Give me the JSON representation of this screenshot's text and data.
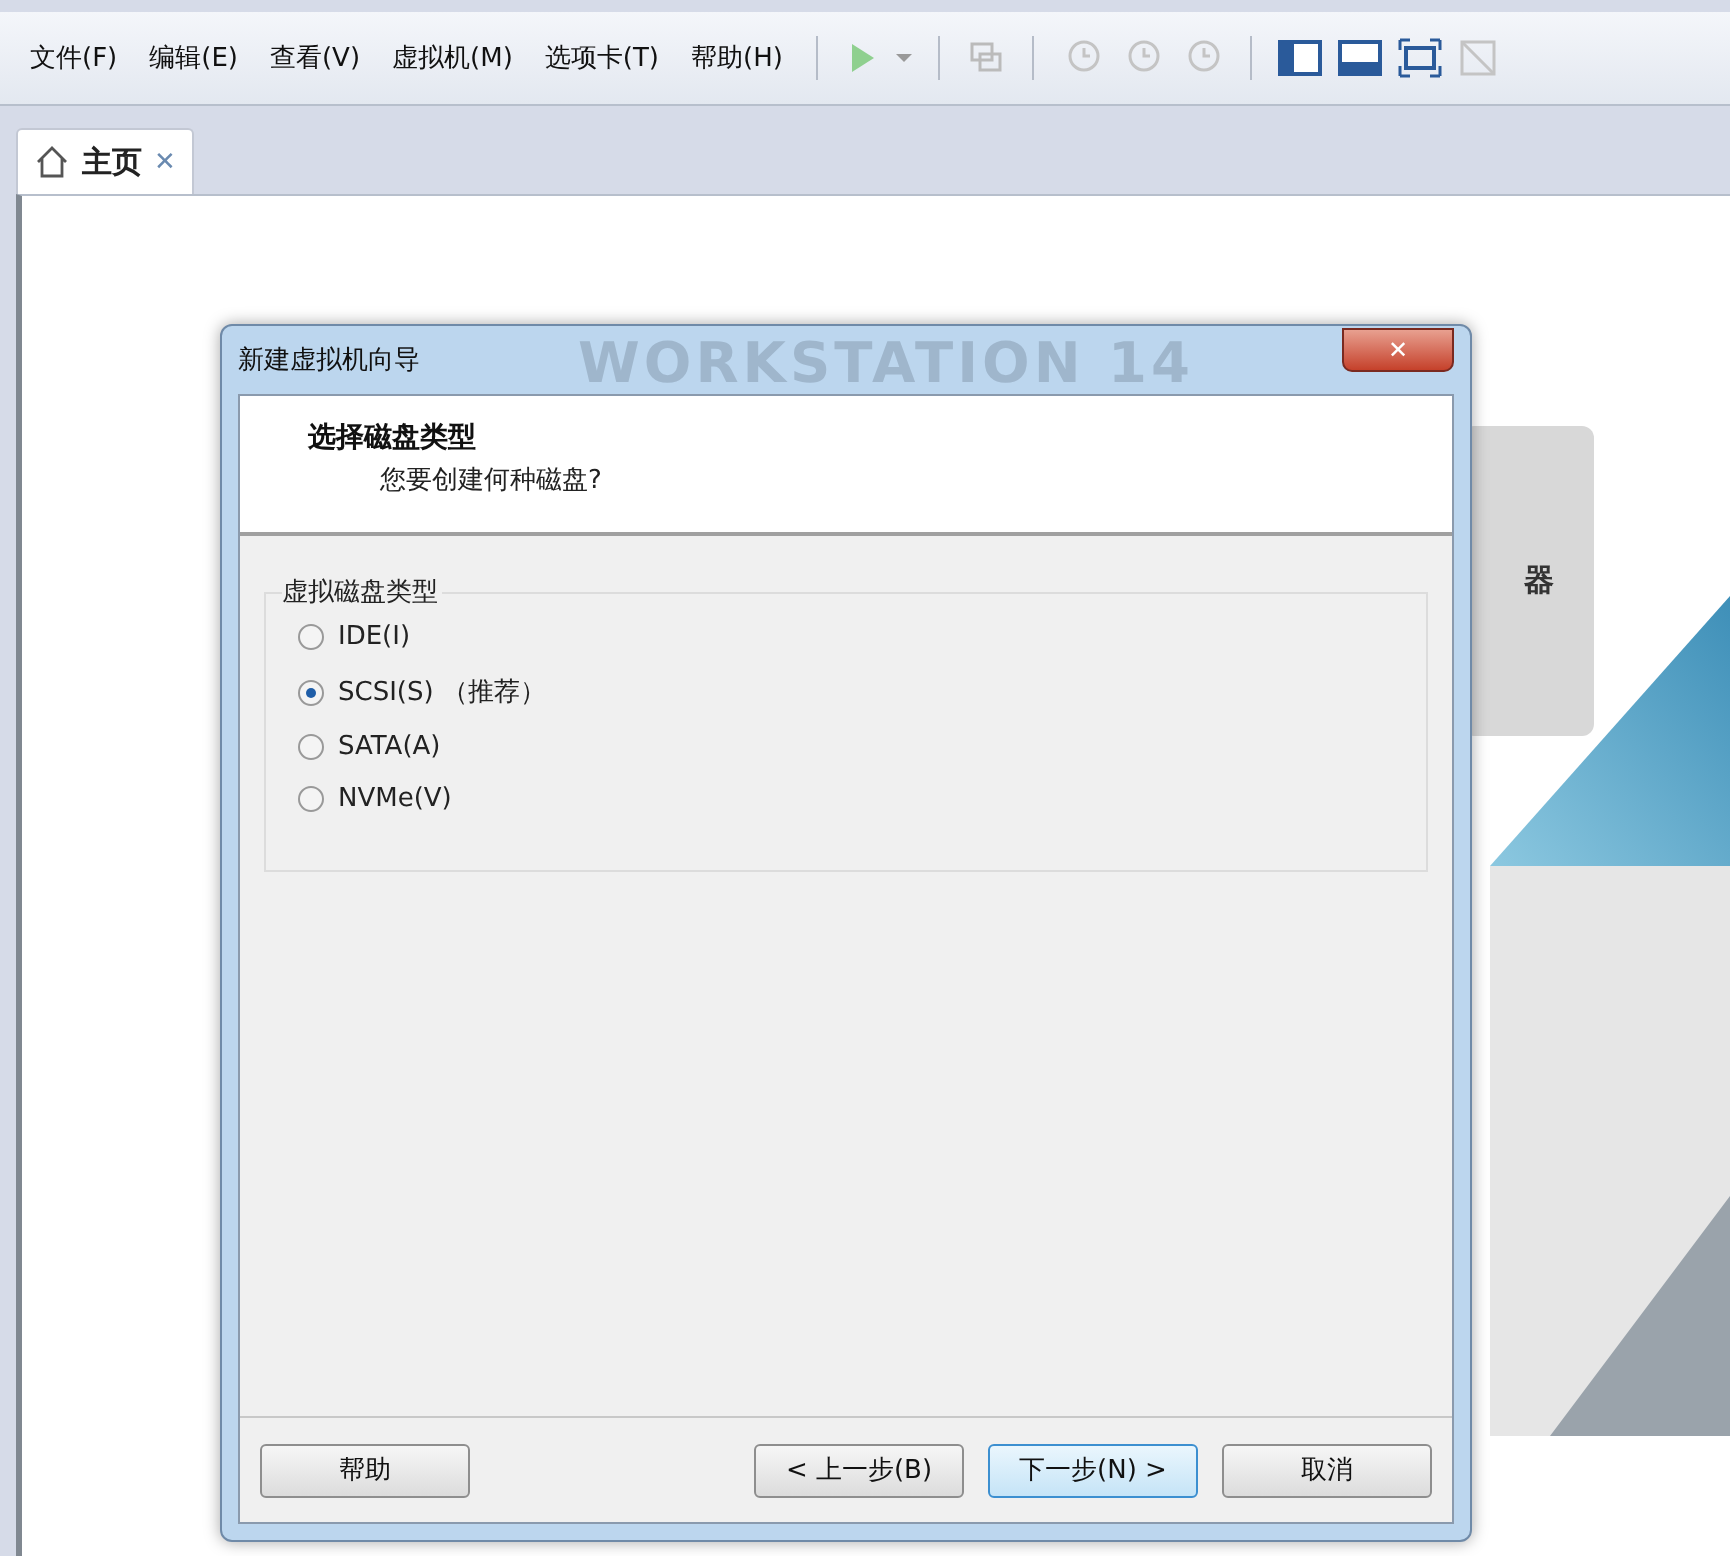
{
  "menu": [
    {
      "label": "文件(F)"
    },
    {
      "label": "编辑(E)"
    },
    {
      "label": "查看(V)"
    },
    {
      "label": "虚拟机(M)"
    },
    {
      "label": "选项卡(T)"
    },
    {
      "label": "帮助(H)"
    }
  ],
  "tabs": [
    {
      "label": "主页",
      "close": "✕",
      "selected": true
    }
  ],
  "home": {
    "card_text": "器",
    "watermark": "WORKSTATION 14"
  },
  "dialog": {
    "title": "新建虚拟机向导",
    "close": "✕",
    "heading": "选择磁盘类型",
    "subheading": "您要创建何种磁盘?",
    "group_label": "虚拟磁盘类型",
    "options": [
      {
        "label": "IDE(I)",
        "selected": false
      },
      {
        "label": "SCSI(S) （推荐）",
        "selected": true
      },
      {
        "label": "SATA(A)",
        "selected": false
      },
      {
        "label": "NVMe(V)",
        "selected": false
      }
    ],
    "buttons": [
      {
        "label": "帮助",
        "default": false
      },
      {
        "label": "< 上一步(B)",
        "default": false
      },
      {
        "label": "下一步(N) >",
        "default": true
      },
      {
        "label": "取消",
        "default": false
      }
    ]
  }
}
